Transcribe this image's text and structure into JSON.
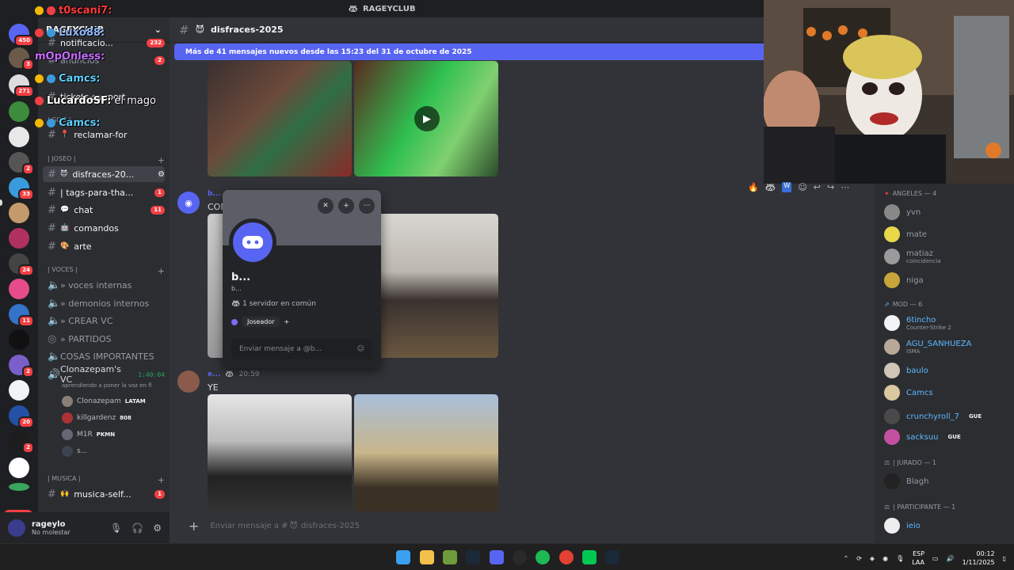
{
  "window": {
    "title": "RAGEYCLUB"
  },
  "server": {
    "name": "RAGEYCLUB"
  },
  "rail": {
    "badges": [
      "450",
      "3",
      "271",
      "2",
      "33",
      "24",
      "11",
      "2",
      "20",
      "2"
    ],
    "new_label": "NUEVO"
  },
  "sidebar": {
    "top_channels": [
      {
        "name": "notificacio...",
        "badge": "232"
      },
      {
        "name": "anuncios",
        "badge": "2"
      },
      {
        "name": "tickets-support",
        "badge": ""
      }
    ],
    "category_jsd": "| GIBS |",
    "reclamar": "reclamar-for",
    "category_joseo": "| JOSEO |",
    "channels": [
      {
        "name": "disfraces-20...",
        "badge": "",
        "selected": true
      },
      {
        "name": "| tags-para-tha...",
        "badge": "1"
      },
      {
        "name": "chat",
        "badge": "11"
      },
      {
        "name": "comandos",
        "badge": ""
      },
      {
        "name": "arte",
        "badge": ""
      }
    ],
    "category_voces": "| VOCES |",
    "voice_channels": [
      "» voces internas",
      "» demonios internos",
      "» CREAR VC",
      "» PARTIDOS",
      "COSAS IMPORTANTES"
    ],
    "vc": {
      "name": "Clonazepam's VC",
      "timer": "1:40:04",
      "status": "aprendiendo a poner la voz en fl",
      "users": [
        {
          "name": "Clonazepam",
          "tag": "LATAM"
        },
        {
          "name": "killgardenz",
          "tag": "808"
        },
        {
          "name": "M1R",
          "tag": "PKMN"
        },
        {
          "name": "s...",
          "tag": ""
        }
      ]
    },
    "category_musica": "| MUSICA |",
    "musica_channel": {
      "name": "musica-self...",
      "badge": "1"
    }
  },
  "user_panel": {
    "name": "rageylo",
    "status": "No molestar"
  },
  "chat": {
    "channel": "disfraces-2025",
    "new_messages_bar": "Más de 41 mensajes nuevos desde las 15:23 del 31 de octubre de 2025",
    "msg1": {
      "author": "b...",
      "text": "CON"
    },
    "msg2": {
      "author": "e...",
      "time": "20:59",
      "text": "YE"
    },
    "composer_placeholder": "Enviar mensaje a #",
    "composer_channel": "disfraces-2025"
  },
  "popup": {
    "display_name": "b...",
    "username": "b...",
    "mutual": "1 servidor en común",
    "role": "Joseador",
    "dm_placeholder": "Enviar mensaje a @b..."
  },
  "members": {
    "angeles": {
      "label": "ANGELES — 4",
      "users": [
        "yvn",
        "mate",
        "matiaz",
        "niga"
      ],
      "matiaz_sub": "coincidencia"
    },
    "mod": {
      "label": "Mod — 6",
      "users": [
        {
          "name": "6tincho",
          "sub": "Counter-Strike 2",
          "tag": ""
        },
        {
          "name": "AGU_SANHUEZA",
          "sub": "ISMA",
          "tag": ""
        },
        {
          "name": "baulo",
          "sub": "",
          "tag": ""
        },
        {
          "name": "Camcs",
          "sub": "",
          "tag": ""
        },
        {
          "name": "crunchyroll_7",
          "sub": "",
          "tag": "GUE"
        },
        {
          "name": "sacksuu",
          "sub": "",
          "tag": "GUE"
        }
      ]
    },
    "jurado": {
      "label": "| Jurado — 1",
      "users": [
        "Blagh"
      ]
    },
    "participante": {
      "label": "| Participante — 1",
      "users": [
        "ieio"
      ]
    }
  },
  "overlay": [
    {
      "user": "t0scani7:",
      "color": "#ff3b3b",
      "msg": ""
    },
    {
      "user": "Luxo88:",
      "color": "#8fb8ff",
      "msg": ""
    },
    {
      "user": "mOpOnless:",
      "color": "#c76bff",
      "msg": ""
    },
    {
      "user": "Camcs:",
      "color": "#5fd0ff",
      "msg": ""
    },
    {
      "user": "LucardoSF:",
      "color": "#ffffff",
      "msg": "el mago"
    },
    {
      "user": "Camcs:",
      "color": "#5fd0ff",
      "msg": ""
    }
  ],
  "taskbar": {
    "lang1": "ESP",
    "lang2": "LAA",
    "time": "00:12",
    "date": "1/11/2025"
  },
  "colors": {
    "accent": "#5865f2",
    "bg_chat": "#313338",
    "bg_sidebar": "#2b2d31",
    "danger": "#f23f43"
  }
}
